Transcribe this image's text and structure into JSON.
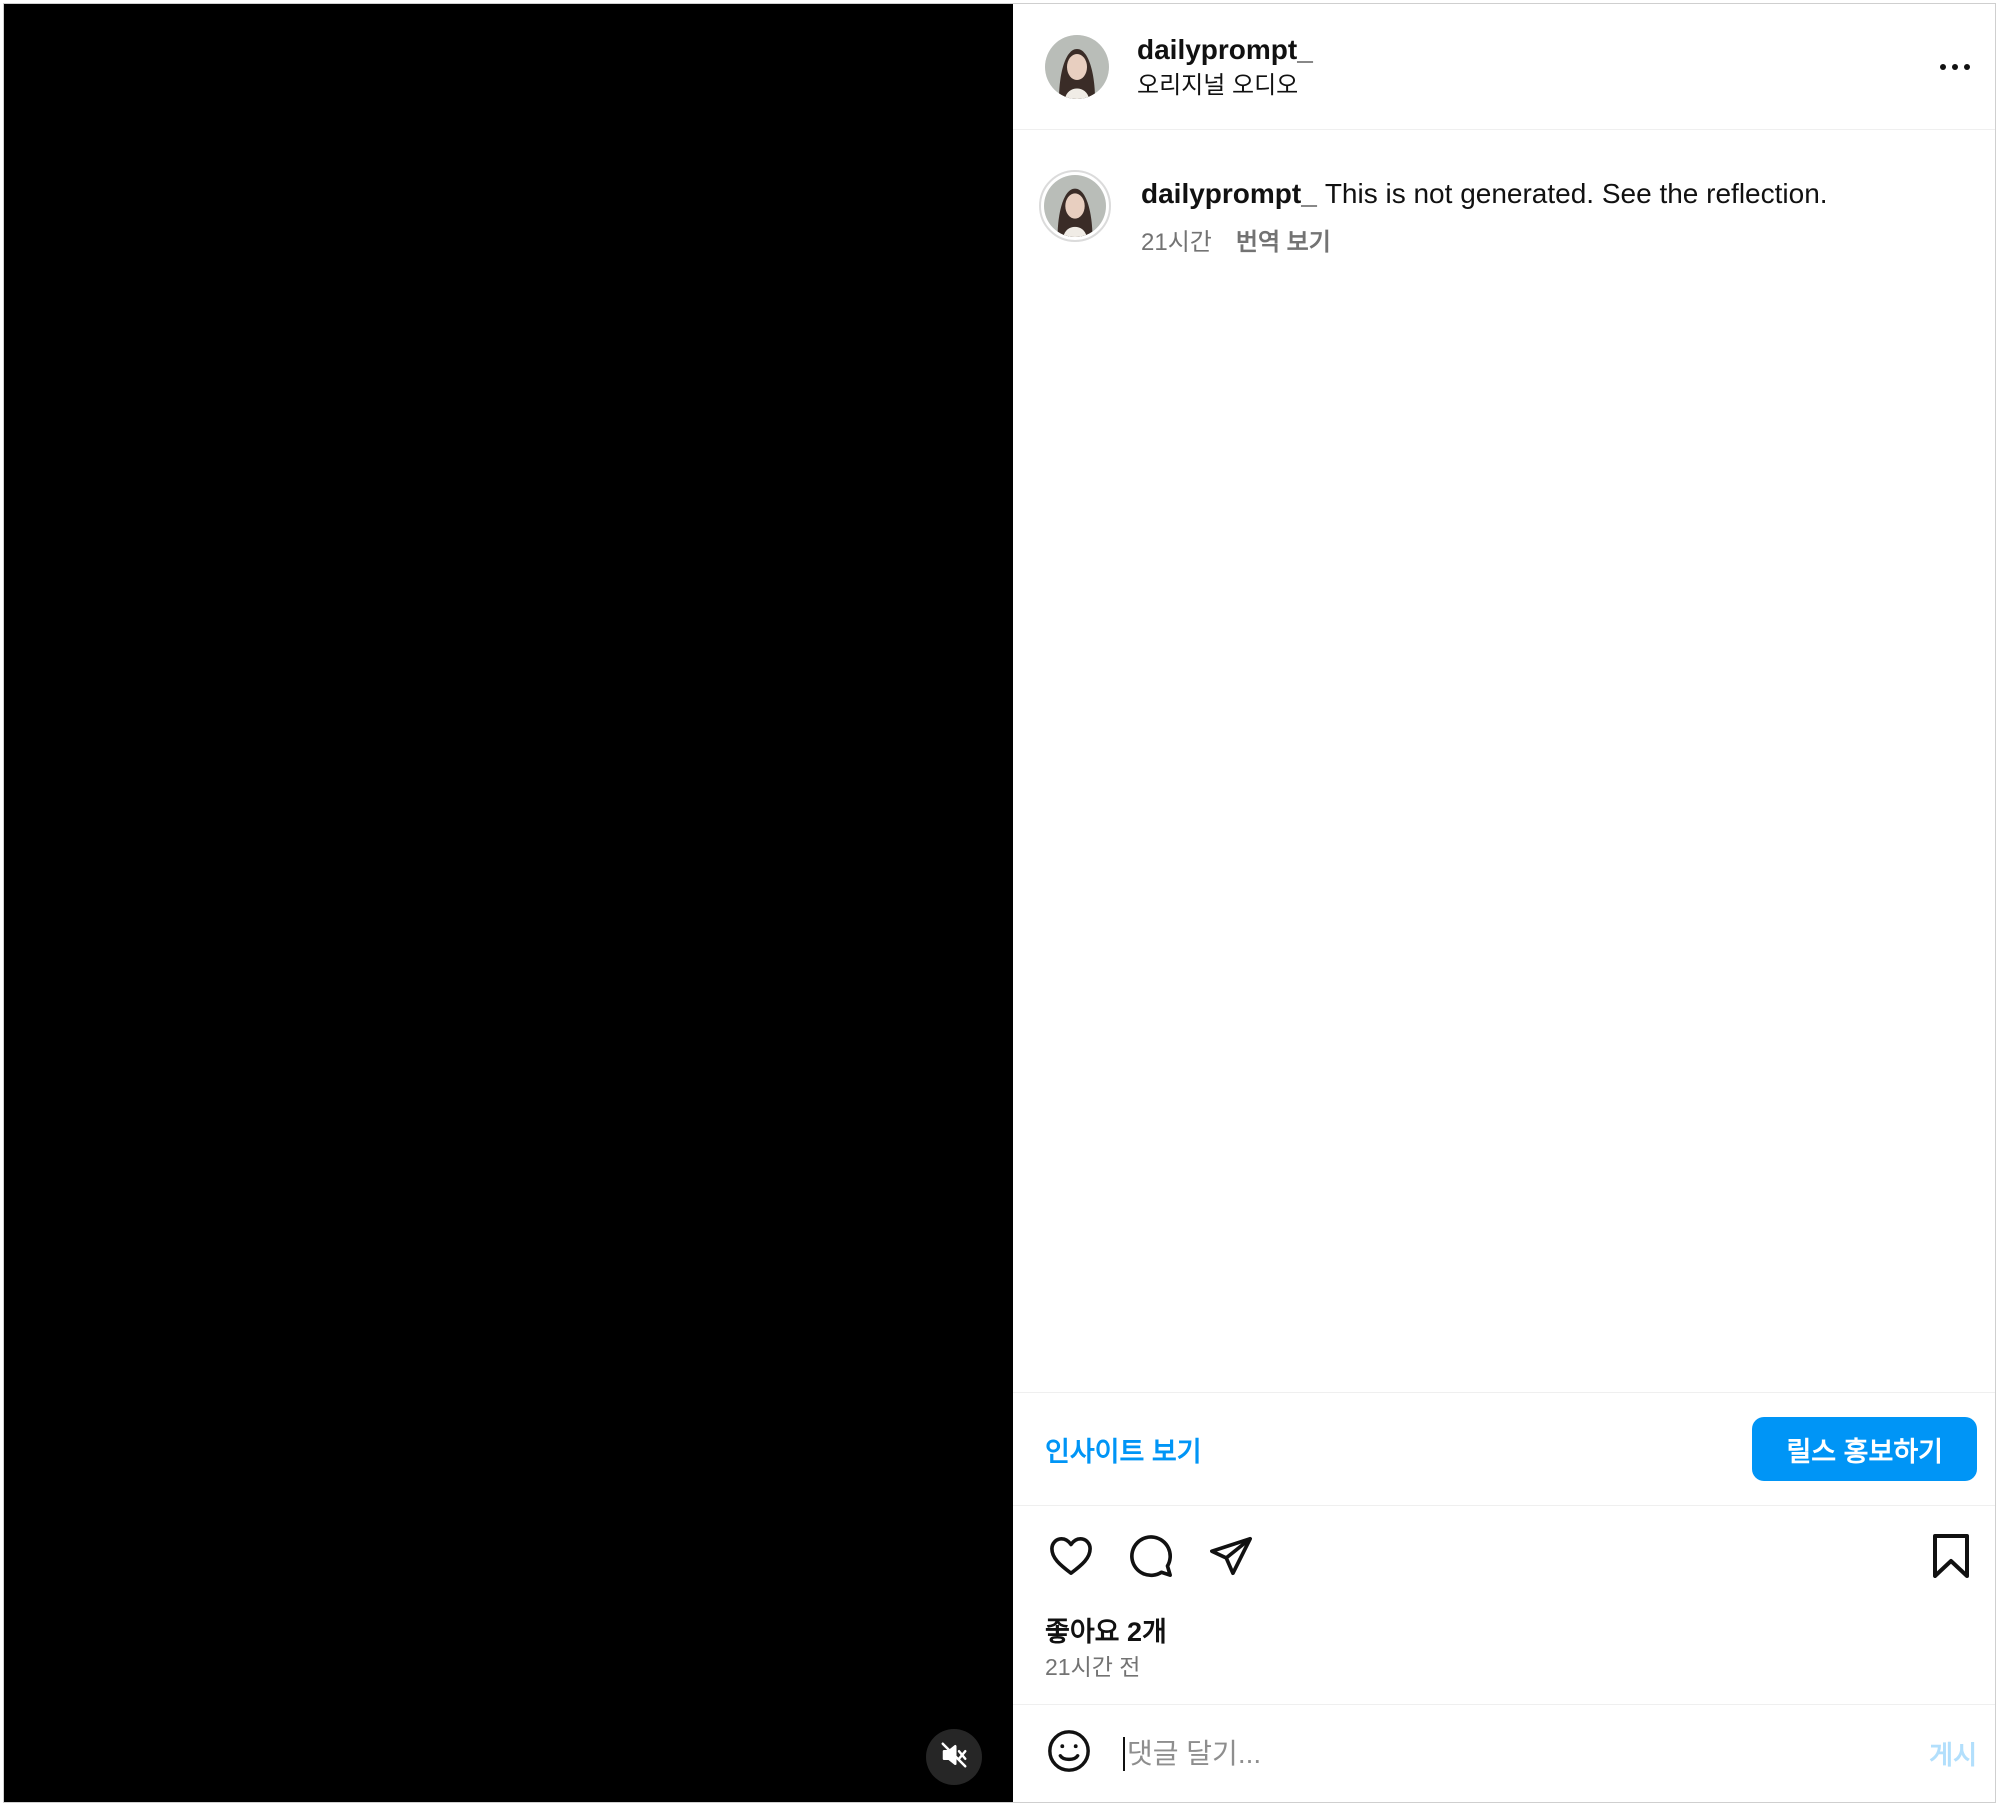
{
  "post": {
    "username": "dailyprompt_",
    "audio_label": "오리지널 오디오",
    "caption_text": "This is not generated. See the reflection.",
    "caption_age": "21시간",
    "translate_label": "번역 보기"
  },
  "insights": {
    "view_insights_label": "인사이트 보기",
    "promote_label": "릴스 홍보하기"
  },
  "engagement": {
    "likes_label": "좋아요 2개",
    "posted_ago": "21시간 전"
  },
  "composer": {
    "placeholder": "댓글 달기...",
    "post_label": "게시"
  },
  "icons": {
    "mute": "speaker-muted-icon",
    "more": "more-horizontal-icon",
    "like": "heart-icon",
    "comment": "comment-bubble-icon",
    "share": "paper-plane-icon",
    "save": "bookmark-icon",
    "emoji": "smiley-icon"
  },
  "colors": {
    "accent": "#0095f6",
    "post_disabled": "#b2dffc",
    "muted_text": "#737373"
  }
}
